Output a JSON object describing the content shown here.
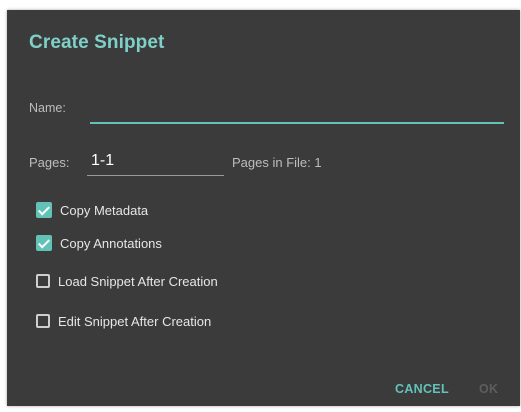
{
  "dialog": {
    "title": "Create Snippet",
    "accent_color": "#63c2b8",
    "background_color": "#3b3b3b"
  },
  "name_field": {
    "label": "Name:",
    "value": ""
  },
  "pages_field": {
    "label": "Pages:",
    "value": "1-1",
    "pages_in_file_label": "Pages in File: 1"
  },
  "options": [
    {
      "label": "Copy Metadata",
      "checked": true
    },
    {
      "label": "Copy Annotations",
      "checked": true
    },
    {
      "label": "Load Snippet After Creation",
      "checked": false
    },
    {
      "label": "Edit Snippet After Creation",
      "checked": false
    }
  ],
  "buttons": {
    "cancel": "CANCEL",
    "ok": "OK"
  }
}
